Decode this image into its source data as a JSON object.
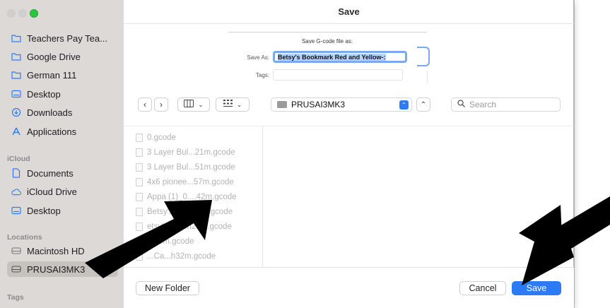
{
  "window": {
    "title": "Save"
  },
  "sidebar": {
    "favorites": [
      {
        "label": "Teachers Pay Tea...",
        "icon": "folder-icon"
      },
      {
        "label": "Google Drive",
        "icon": "folder-icon"
      },
      {
        "label": "German 111",
        "icon": "folder-icon"
      },
      {
        "label": "Desktop",
        "icon": "desktop-icon"
      },
      {
        "label": "Downloads",
        "icon": "downloads-icon"
      },
      {
        "label": "Applications",
        "icon": "applications-icon"
      }
    ],
    "icloud_heading": "iCloud",
    "icloud": [
      {
        "label": "Documents",
        "icon": "document-icon"
      },
      {
        "label": "iCloud Drive",
        "icon": "cloud-icon"
      },
      {
        "label": "Desktop",
        "icon": "desktop-icon"
      }
    ],
    "locations_heading": "Locations",
    "locations": [
      {
        "label": "Macintosh HD",
        "icon": "disk-icon"
      },
      {
        "label": "PRUSAI3MK3",
        "icon": "disk-icon",
        "selected": true
      }
    ],
    "tags_heading": "Tags"
  },
  "form": {
    "heading": "Save G-code file as:",
    "save_as_label": "Save As:",
    "save_as_value": "Betsy's Bookmark Red and Yellow-:",
    "tags_label": "Tags:"
  },
  "toolbar": {
    "location": "PRUSAI3MK3",
    "search_placeholder": "Search"
  },
  "files": [
    "0.gcode",
    "3 Layer Bul...21m.gcode",
    "3 Layer Bul...51m.gcode",
    "4x6 pionee...57m.gcode",
    "Appa (1)_0....42m.gcode",
    "Betsy's Ca...45m.gcode",
    "etsy's Ca...h29m.gcode",
    "...39m.gcode",
    "...Ca...h32m.gcode"
  ],
  "buttons": {
    "new_folder": "New Folder",
    "cancel": "Cancel",
    "save": "Save"
  },
  "colors": {
    "accent": "#2d7bf4",
    "sidebar_bg": "#dcd9d6",
    "annotation_arrow": "#000000"
  }
}
